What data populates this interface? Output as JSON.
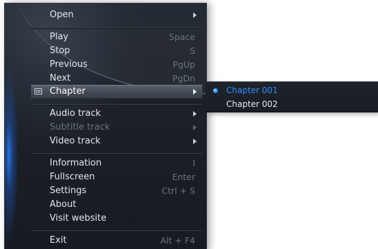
{
  "menu": {
    "items": [
      {
        "label": "Open",
        "shortcut": "",
        "submenu": true,
        "disabled": false
      },
      {
        "label": "Play",
        "shortcut": "Space",
        "submenu": false,
        "disabled": false
      },
      {
        "label": "Stop",
        "shortcut": "S",
        "submenu": false,
        "disabled": false
      },
      {
        "label": "Previous",
        "shortcut": "PgUp",
        "submenu": false,
        "disabled": false
      },
      {
        "label": "Next",
        "shortcut": "PgDn",
        "submenu": false,
        "disabled": false
      },
      {
        "label": "Chapter",
        "shortcut": "",
        "submenu": true,
        "disabled": false,
        "highlighted": true,
        "icon": "chapter-list-icon"
      },
      {
        "label": "Audio track",
        "shortcut": "",
        "submenu": true,
        "disabled": false
      },
      {
        "label": "Subtitle track",
        "shortcut": "",
        "submenu": true,
        "disabled": true
      },
      {
        "label": "Video track",
        "shortcut": "",
        "submenu": true,
        "disabled": false
      },
      {
        "label": "Information",
        "shortcut": "I",
        "submenu": false,
        "disabled": false
      },
      {
        "label": "Fullscreen",
        "shortcut": "Enter",
        "submenu": false,
        "disabled": false
      },
      {
        "label": "Settings",
        "shortcut": "Ctrl + S",
        "submenu": false,
        "disabled": false
      },
      {
        "label": "About",
        "shortcut": "",
        "submenu": false,
        "disabled": false
      },
      {
        "label": "Visit website",
        "shortcut": "",
        "submenu": false,
        "disabled": false
      },
      {
        "label": "Exit",
        "shortcut": "Alt + F4",
        "submenu": false,
        "disabled": false
      }
    ]
  },
  "chapter_submenu": {
    "items": [
      {
        "label": "Chapter 001",
        "selected": true
      },
      {
        "label": "Chapter 002",
        "selected": false
      }
    ]
  },
  "colors": {
    "accent": "#2f8cff",
    "menu_bg": "#1d2229",
    "disabled_text": "#6a727d",
    "shortcut_text": "#6b7480"
  }
}
